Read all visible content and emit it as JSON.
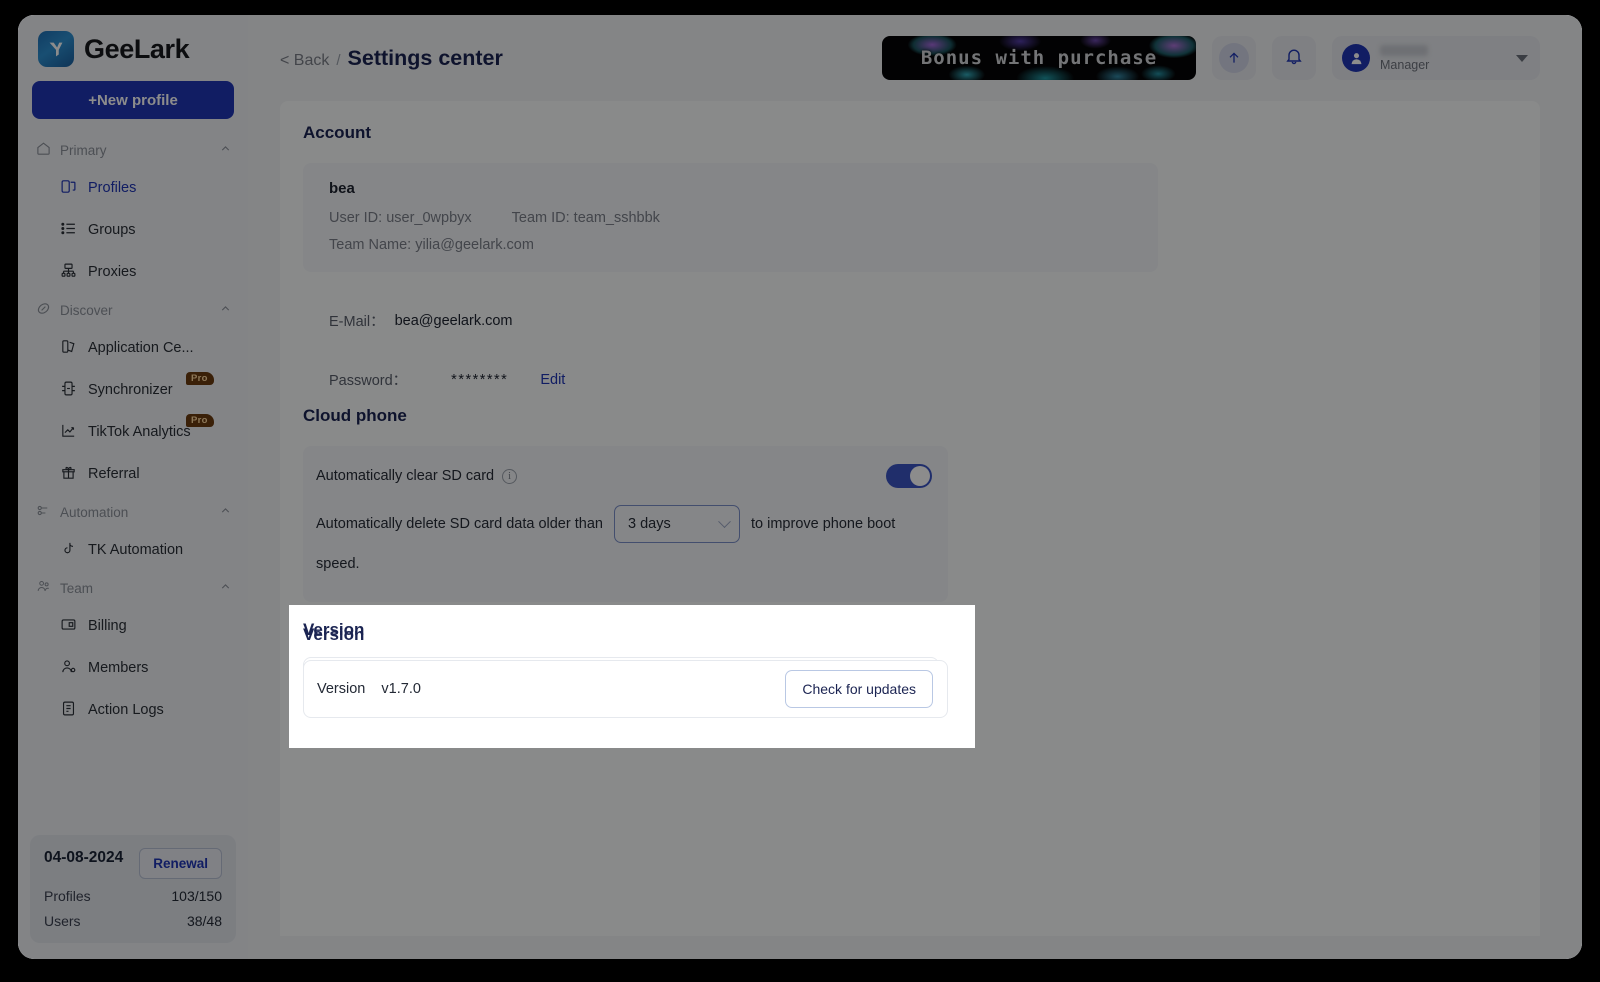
{
  "brand": {
    "name": "GeeLark",
    "logo_icon": "geelark-logo-icon"
  },
  "sidebar": {
    "new_profile_label": "+New profile",
    "groups": [
      {
        "label": "Primary",
        "icon": "home-icon",
        "items": [
          {
            "label": "Profiles",
            "icon": "profiles-icon",
            "active": true
          },
          {
            "label": "Groups",
            "icon": "list-icon",
            "active": false
          },
          {
            "label": "Proxies",
            "icon": "network-icon",
            "active": false
          }
        ]
      },
      {
        "label": "Discover",
        "icon": "compass-icon",
        "items": [
          {
            "label": "Application Ce...",
            "icon": "apps-icon",
            "active": false
          },
          {
            "label": "Synchronizer",
            "icon": "sync-icon",
            "active": false,
            "badge": "Pro"
          },
          {
            "label": "TikTok Analytics",
            "icon": "analytics-icon",
            "active": false,
            "badge": "Pro"
          },
          {
            "label": "Referral",
            "icon": "gift-icon",
            "active": false
          }
        ]
      },
      {
        "label": "Automation",
        "icon": "automation-icon",
        "items": [
          {
            "label": "TK Automation",
            "icon": "tiktok-icon",
            "active": false
          }
        ]
      },
      {
        "label": "Team",
        "icon": "team-icon",
        "items": [
          {
            "label": "Billing",
            "icon": "card-icon",
            "active": false
          },
          {
            "label": "Members",
            "icon": "member-icon",
            "active": false
          },
          {
            "label": "Action Logs",
            "icon": "logs-icon",
            "active": false
          }
        ]
      }
    ],
    "usage_card": {
      "expiry_date": "04-08-2024",
      "renewal_label": "Renewal",
      "rows": [
        {
          "label": "Profiles",
          "value": "103/150"
        },
        {
          "label": "Users",
          "value": "38/48"
        }
      ]
    }
  },
  "topbar": {
    "back_label": "< Back",
    "separator": "/",
    "page_title": "Settings center",
    "promo_banner": "Bonus with purchase",
    "upload_icon": "upload-arrow-icon",
    "bell_icon": "bell-icon",
    "user": {
      "name": "",
      "role": "Manager",
      "avatar_icon": "user-avatar-icon"
    }
  },
  "account": {
    "title": "Account",
    "name": "bea",
    "user_id": "User ID: user_0wpbyx",
    "team_id": "Team ID: team_sshbbk",
    "team_name": "Team Name: yilia@geelark.com",
    "email_label": "E-Mail：",
    "email_value": "bea@geelark.com",
    "password_label": "Password：",
    "password_value": "********",
    "edit_label": "Edit"
  },
  "cloud_phone": {
    "title": "Cloud phone",
    "auto_clear_label": "Automatically clear SD card",
    "info_icon": "info-icon",
    "toggle_on": true,
    "desc_before": "Automatically delete SD card data older than",
    "retention_value": "3 days",
    "desc_after": "to improve phone boot speed."
  },
  "version": {
    "title": "Version",
    "row_label": "Version",
    "value": "v1.7.0",
    "check_label": "Check for updates"
  },
  "colors": {
    "accent": "#1f35b5",
    "title": "#1b2452",
    "toggle_on": "#3b55c4",
    "badge_bg": "#6b3b10",
    "badge_text": "#ffd9a0"
  }
}
